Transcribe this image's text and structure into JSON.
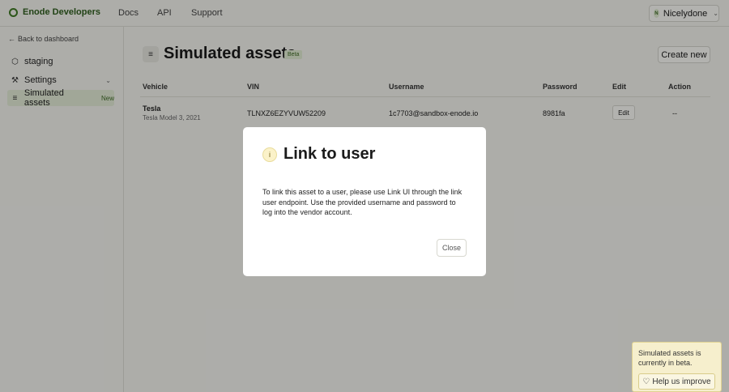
{
  "topbar": {
    "brand": "Enode Developers",
    "nav": [
      "Docs",
      "API",
      "Support"
    ],
    "user": {
      "initial": "N",
      "name": "Nicelydone"
    }
  },
  "sidebar": {
    "back": "Back to dashboard",
    "items": [
      {
        "label": "staging",
        "icon": "cube-icon"
      },
      {
        "label": "Settings",
        "icon": "wrench-icon"
      },
      {
        "label": "Simulated assets",
        "icon": "list-icon",
        "badge": "New"
      }
    ]
  },
  "page": {
    "title": "Simulated assets",
    "badge": "Beta",
    "create_button": "Create new"
  },
  "table": {
    "headers": [
      "Vehicle",
      "VIN",
      "Username",
      "Password",
      "Edit",
      "Action"
    ],
    "rows": [
      {
        "vehicle": "Tesla",
        "model": "Tesla Model 3, 2021",
        "vin": "TLNXZ6EZYVUW52209",
        "username": "1c7703@sandbox-enode.io",
        "password": "8981fa",
        "edit": "Edit",
        "action": "--"
      }
    ]
  },
  "modal": {
    "title": "Link to user",
    "body": "To link this asset to a user, please use Link UI through the link user endpoint. Use the provided username and password to log into the vendor account.",
    "close": "Close"
  },
  "beta_notice": {
    "text": "Simulated assets is currently in beta.",
    "help": "Help us improve"
  },
  "colors": {
    "brand": "#2f5d1e",
    "active_bg": "#e3ebd7",
    "notice_bg": "#f6efcd"
  }
}
